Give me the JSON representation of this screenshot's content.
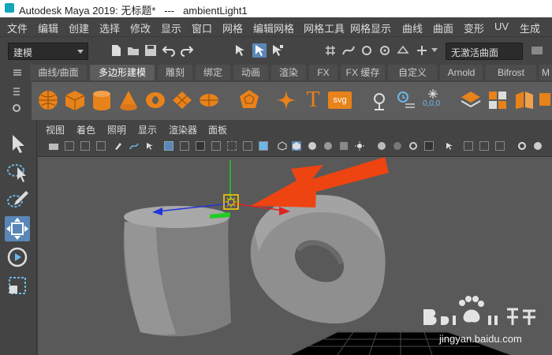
{
  "titlebar": {
    "title": "Autodesk Maya 2019: 无标题*   ---   ambientLight1"
  },
  "menubar": {
    "items": [
      "文件",
      "编辑",
      "创建",
      "选择",
      "修改",
      "显示",
      "窗口",
      "网格",
      "编辑网格",
      "网格工具",
      "网格显示",
      "曲线",
      "曲面",
      "变形",
      "UV",
      "生成"
    ]
  },
  "status_line": {
    "mode": "建模",
    "live_surface": "无激活曲面"
  },
  "shelf": {
    "tabs": [
      "曲线/曲面",
      "多边形建模",
      "雕刻",
      "绑定",
      "动画",
      "渲染",
      "FX",
      "FX 缓存",
      "自定义",
      "Arnold",
      "Bifrost",
      "M"
    ],
    "active_tab": "多边形建模",
    "svg_label": "svg",
    "text_label": "T",
    "coords_label": "0,0,0"
  },
  "viewport": {
    "menu": [
      "视图",
      "着色",
      "照明",
      "显示",
      "渲染器",
      "面板"
    ]
  },
  "watermark": {
    "brand": "Baidu 经验",
    "url": "jingyan.baidu.com"
  },
  "colors": {
    "scene": "#595959",
    "arrow": "#ee4411",
    "manipulator_box": "#ffd400"
  }
}
